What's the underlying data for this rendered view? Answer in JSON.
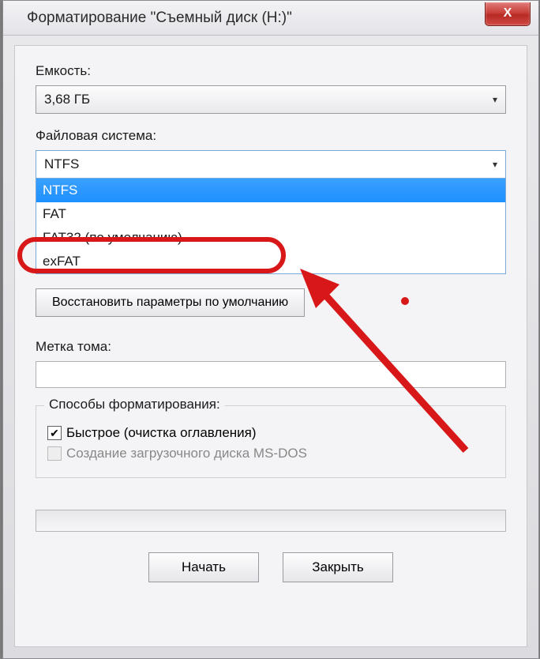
{
  "window": {
    "title": "Форматирование \"Съемный диск (H:)\"",
    "close_symbol": "X"
  },
  "capacity": {
    "label": "Емкость:",
    "value": "3,68 ГБ"
  },
  "filesystem": {
    "label": "Файловая система:",
    "selected": "NTFS",
    "options": [
      "NTFS",
      "FAT",
      "FAT32 (по умолчанию)",
      "exFAT"
    ]
  },
  "reset_button": "Восстановить параметры по умолчанию",
  "volume_label": {
    "label": "Метка тома:",
    "value": ""
  },
  "format_options": {
    "legend": "Способы форматирования:",
    "quick": {
      "label": "Быстрое (очистка оглавления)",
      "checked": true
    },
    "msdos": {
      "label": "Создание загрузочного диска MS-DOS",
      "checked": false,
      "disabled": true
    }
  },
  "buttons": {
    "start": "Начать",
    "close": "Закрыть"
  }
}
